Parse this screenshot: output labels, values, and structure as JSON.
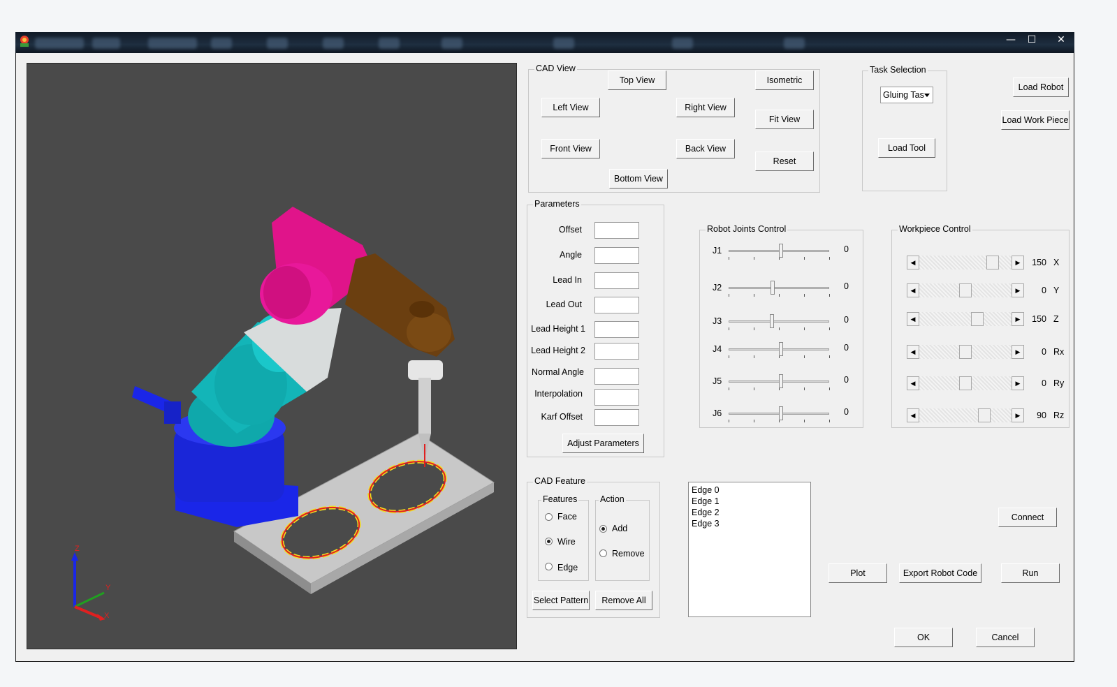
{
  "window": {
    "minimize": "—",
    "maximize": "☐",
    "close": "✕"
  },
  "cad_view": {
    "title": "CAD View",
    "buttons": {
      "top": "Top View",
      "isometric": "Isometric",
      "left": "Left View",
      "right": "Right View",
      "fit": "Fit View",
      "front": "Front View",
      "back": "Back View",
      "reset": "Reset",
      "bottom": "Bottom View"
    }
  },
  "task_selection": {
    "title": "Task Selection",
    "selected": "Gluing Tas",
    "load_tool": "Load Tool"
  },
  "top_right": {
    "load_robot": "Load Robot",
    "load_work_piece": "Load Work Piece"
  },
  "parameters": {
    "title": "Parameters",
    "fields": [
      {
        "label": "Offset",
        "value": ""
      },
      {
        "label": "Angle",
        "value": ""
      },
      {
        "label": "Lead In",
        "value": ""
      },
      {
        "label": "Lead Out",
        "value": ""
      },
      {
        "label": "Lead Height 1",
        "value": ""
      },
      {
        "label": "Lead Height 2",
        "value": ""
      },
      {
        "label": "Normal Angle",
        "value": ""
      },
      {
        "label": "Interpolation",
        "value": ""
      },
      {
        "label": "Karf Offset",
        "value": ""
      }
    ],
    "adjust": "Adjust Parameters"
  },
  "robot_joints": {
    "title": "Robot Joints Control",
    "joints": [
      {
        "name": "J1",
        "value": "0",
        "level": 0.52
      },
      {
        "name": "J2",
        "value": "0",
        "level": 0.44
      },
      {
        "name": "J3",
        "value": "0",
        "level": 0.43
      },
      {
        "name": "J4",
        "value": "0",
        "level": 0.52
      },
      {
        "name": "J5",
        "value": "0",
        "level": 0.52
      },
      {
        "name": "J6",
        "value": "0",
        "level": 0.52
      }
    ]
  },
  "workpiece": {
    "title": "Workpiece Control",
    "rows": [
      {
        "axis": "X",
        "value": "150",
        "level": 0.84
      },
      {
        "axis": "Y",
        "value": "0",
        "level": 0.5
      },
      {
        "axis": "Z",
        "value": "150",
        "level": 0.65
      },
      {
        "axis": "Rx",
        "value": "0",
        "level": 0.5
      },
      {
        "axis": "Ry",
        "value": "0",
        "level": 0.5
      },
      {
        "axis": "Rz",
        "value": "90",
        "level": 0.74
      }
    ]
  },
  "cad_feature": {
    "title": "CAD Feature",
    "features_title": "Features",
    "features": [
      {
        "label": "Face",
        "checked": false
      },
      {
        "label": "Wire",
        "checked": true
      },
      {
        "label": "Edge",
        "checked": false
      }
    ],
    "action_title": "Action",
    "actions": [
      {
        "label": "Add",
        "checked": true
      },
      {
        "label": "Remove",
        "checked": false
      }
    ],
    "select_pattern": "Select Pattern",
    "remove_all": "Remove All"
  },
  "edges": [
    "Edge 0",
    "Edge 1",
    "Edge 2",
    "Edge 3"
  ],
  "bottom": {
    "connect": "Connect",
    "plot": "Plot",
    "export": "Export Robot Code",
    "run": "Run",
    "ok": "OK",
    "cancel": "Cancel"
  },
  "axes": {
    "x": "X",
    "y": "Y",
    "z": "Z"
  },
  "colors": {
    "viewport_bg": "#4a4a4a",
    "robot_magenta": "#e0148a",
    "robot_cyan": "#13b5b8",
    "robot_blue": "#1a26e8",
    "robot_brown": "#6b3f10",
    "path_red": "#e02020",
    "path_yellow": "#f0e020"
  }
}
